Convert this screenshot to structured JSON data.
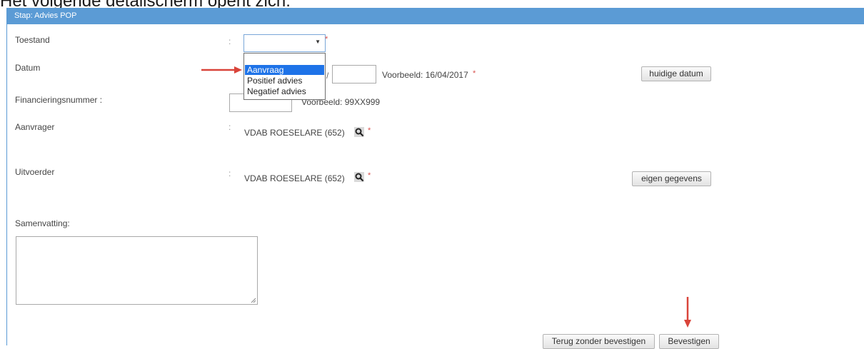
{
  "caption": "Het volgende detailscherm opent zich:",
  "panel": {
    "title": "Stap: Advies POP"
  },
  "form": {
    "colon": ":",
    "required_mark": "*",
    "toestand": {
      "label": "Toestand",
      "selected_value": "",
      "options": [
        "",
        "Aanvraag",
        "Positief advies",
        "Negatief advies"
      ],
      "highlighted_option": "Aanvraag"
    },
    "datum": {
      "label": "Datum",
      "separator": "/",
      "hint": "Voorbeeld: 16/04/2017",
      "button_label": "huidige datum"
    },
    "financieringsnummer": {
      "label": "Financieringsnummer :",
      "hint": "Voorbeeld: 99XX999"
    },
    "aanvrager": {
      "label": "Aanvrager",
      "value": "VDAB ROESELARE (652)"
    },
    "uitvoerder": {
      "label": "Uitvoerder",
      "value": "VDAB ROESELARE (652)",
      "button_label": "eigen gegevens"
    },
    "samenvatting": {
      "label": "Samenvatting:",
      "value": ""
    }
  },
  "footer": {
    "back_label": "Terug zonder bevestigen",
    "confirm_label": "Bevestigen"
  },
  "icons": {
    "search": "magnifier-icon",
    "arrow": "red-arrow-icon"
  },
  "colors": {
    "header_bg": "#5b9bd5",
    "selection": "#1e73e8",
    "required": "#d9534f",
    "annotation_arrow": "#d9443a"
  }
}
